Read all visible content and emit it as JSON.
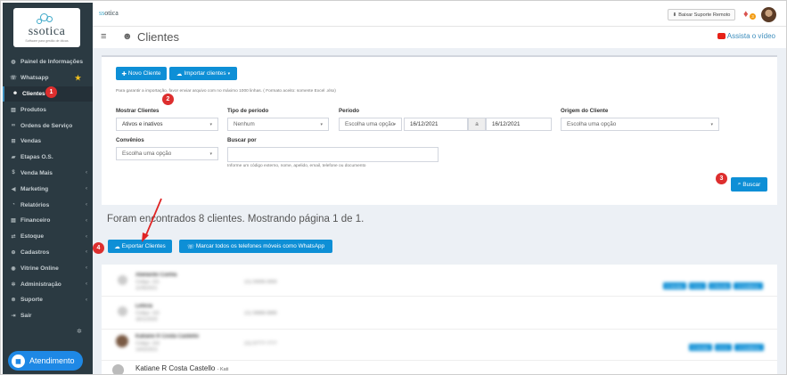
{
  "sidebar": {
    "logo_text": "ssotica",
    "logo_sub": "Software para gestão de óticas",
    "items": [
      {
        "label": "Painel de Informações",
        "icon": "dashboard-icon",
        "glyph": "◍",
        "chevron": false
      },
      {
        "label": "Whatsapp",
        "icon": "whatsapp-icon",
        "glyph": "☏",
        "chevron": false,
        "star": true
      },
      {
        "label": "Clientes",
        "icon": "users-icon",
        "glyph": "☻",
        "chevron": false,
        "active": true
      },
      {
        "label": "Produtos",
        "icon": "barcode-icon",
        "glyph": "▥",
        "chevron": false
      },
      {
        "label": "Ordens de Serviço",
        "icon": "glasses-icon",
        "glyph": "∞",
        "chevron": false
      },
      {
        "label": "Vendas",
        "icon": "cart-icon",
        "glyph": "⊞",
        "chevron": false
      },
      {
        "label": "Etapas O.S.",
        "icon": "truck-icon",
        "glyph": "▰",
        "chevron": false
      },
      {
        "label": "Venda Mais",
        "icon": "dollar-icon",
        "glyph": "$",
        "chevron": true
      },
      {
        "label": "Marketing",
        "icon": "megaphone-icon",
        "glyph": "◀",
        "chevron": true
      },
      {
        "label": "Relatórios",
        "icon": "chart-icon",
        "glyph": "◔",
        "chevron": true
      },
      {
        "label": "Financeiro",
        "icon": "money-icon",
        "glyph": "▤",
        "chevron": true
      },
      {
        "label": "Estoque",
        "icon": "exchange-icon",
        "glyph": "⇄",
        "chevron": true
      },
      {
        "label": "Cadastros",
        "icon": "plus-square-icon",
        "glyph": "⊕",
        "chevron": true
      },
      {
        "label": "Vitrine Online",
        "icon": "globe-icon",
        "glyph": "◉",
        "chevron": true
      },
      {
        "label": "Administração",
        "icon": "cogs-icon",
        "glyph": "✲",
        "chevron": true
      },
      {
        "label": "Suporte",
        "icon": "life-ring-icon",
        "glyph": "⊗",
        "chevron": true
      },
      {
        "label": "Sair",
        "icon": "sign-out-icon",
        "glyph": "⇥",
        "chevron": false
      }
    ],
    "atendimento_label": "Atendimento"
  },
  "topbar": {
    "logo": "ssotica",
    "download_label": "Baixar Suporte Remoto",
    "notification_count": "3"
  },
  "header": {
    "title": "Clientes",
    "video_link": "Assista o vídeo"
  },
  "actions": {
    "new_client": "Novo Cliente",
    "import_clients": "Importar clientes",
    "import_note": "Para garantir a importação, favor enviar arquivo com no máximo 1000 linhas. ( Formato aceito: somente Excel .xlsx)"
  },
  "filters": {
    "mostrar_label": "Mostrar Clientes",
    "mostrar_value": "Ativos e inativos",
    "tipo_label": "Tipo de período",
    "tipo_placeholder": "Nenhum",
    "periodo_label": "Período",
    "periodo_placeholder": "Escolha uma opção",
    "date_from": "16/12/2021",
    "date_sep": "a",
    "date_to": "16/12/2021",
    "origem_label": "Origem do Cliente",
    "origem_placeholder": "Escolha uma opção",
    "convenios_label": "Convênios",
    "convenios_placeholder": "Escolha uma opção",
    "buscar_label": "Buscar por",
    "buscar_help": "Informe um código externo, nome, apelido, email, telefone ou documento",
    "search_button": "Buscar"
  },
  "results": {
    "summary": "Foram encontrados 8 clientes. Mostrando página 1 de 1.",
    "export_button": "Exportar Clientes",
    "whatsapp_button": "Marcar todos os telefones móveis como WhatsApp"
  },
  "clients": [
    {
      "name": "Abelardo Cunha",
      "sub1": "Código: 101",
      "sub2": "11/05/2021",
      "phone": "(11) 99999-9999",
      "tags": [
        "5 Vendas",
        "7 O.S.",
        "1 Receita",
        "3 Crediários"
      ]
    },
    {
      "name": "Letícia",
      "sub1": "Código: 102",
      "sub2": "18/11/2020",
      "phone": "(11) 98888-8888",
      "tags": []
    },
    {
      "name": "Katiane R Costa Castello",
      "sub1": "Código: 103",
      "sub2": "14/02/2021",
      "phone": "(11) 97777-7777",
      "tags": [
        "5 Vendas",
        "2 O.S.",
        "4 Crediários"
      ]
    }
  ],
  "last_client": {
    "name": "Katiane R Costa Castello",
    "nickname": "- Kati"
  },
  "annotations": [
    "1",
    "2",
    "3",
    "4"
  ]
}
